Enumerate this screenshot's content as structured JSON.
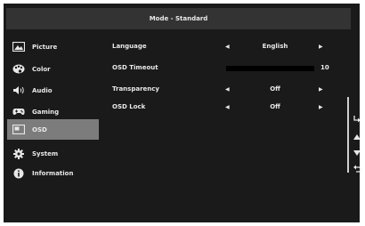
{
  "title": "Mode - Standard",
  "sidebar": {
    "items": [
      {
        "label": "Picture",
        "icon": "picture-icon"
      },
      {
        "label": "Color",
        "icon": "palette-icon"
      },
      {
        "label": "Audio",
        "icon": "speaker-icon"
      },
      {
        "label": "Gaming",
        "icon": "gamepad-icon"
      },
      {
        "label": "OSD",
        "icon": "osd-icon"
      },
      {
        "label": "System",
        "icon": "gear-icon"
      },
      {
        "label": "Information",
        "icon": "info-icon"
      }
    ],
    "active": "OSD"
  },
  "settings": {
    "language": {
      "label": "Language",
      "value": "English"
    },
    "osd_timeout": {
      "label": "OSD Timeout",
      "value": "10"
    },
    "transparency": {
      "label": "Transparency",
      "value": "Off"
    },
    "osd_lock": {
      "label": "OSD Lock",
      "value": "Off"
    }
  },
  "nav": {
    "enter_icon": "enter-icon",
    "up_icon": "triangle-up-icon",
    "down_icon": "triangle-down-icon",
    "back_icon": "back-icon"
  },
  "colors": {
    "background": "#1a1a1a",
    "titlebar": "#333333",
    "active_item": "#7c7c7c",
    "text": "#e8e8e8"
  }
}
